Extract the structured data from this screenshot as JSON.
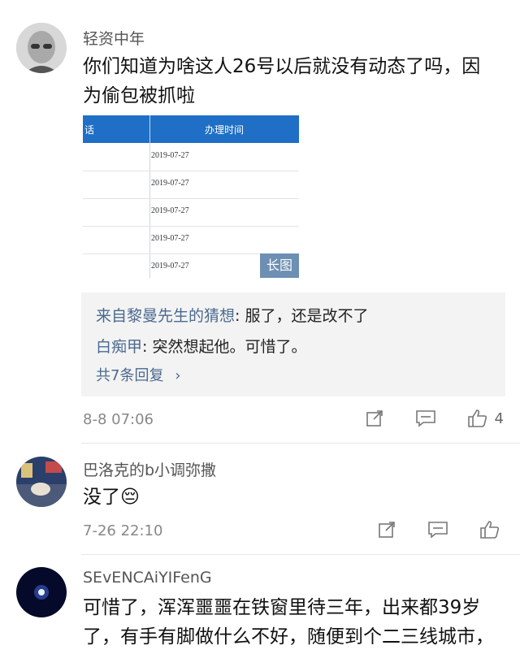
{
  "comments": [
    {
      "username": "轻资中年",
      "text_line1": "你们知道为啥这人26号以后就没有动态了吗，因",
      "text_line2": "为偷包被抓啦",
      "image": {
        "header_left": "话",
        "header_right": "办理时间",
        "dates": [
          "2019-07-27",
          "2019-07-27",
          "2019-07-27",
          "2019-07-27",
          "2019-07-27"
        ],
        "long_image_badge": "长图"
      },
      "replies": [
        {
          "name": "来自黎曼先生的猜想",
          "text": "服了，还是改不了"
        },
        {
          "name": "白痴甲",
          "text": "突然想起他。可惜了。"
        }
      ],
      "more_replies": "共7条回复",
      "timestamp": "8-8 07:06",
      "like_count": "4"
    },
    {
      "username": "巴洛克的b小调弥撒",
      "text": "没了😔",
      "timestamp": "7-26 22:10"
    },
    {
      "username": "SEvENCAiYIFenG",
      "text_line1": "可惜了，浑浑噩噩在铁窗里待三年，出来都39岁",
      "text_line2": "了，有手有脚做什么不好，随便到个二三线城市，"
    }
  ],
  "icons": {
    "share": "share-icon",
    "comment": "comment-icon",
    "like": "thumbs-up-icon",
    "chevron": "chevron-right-icon"
  }
}
